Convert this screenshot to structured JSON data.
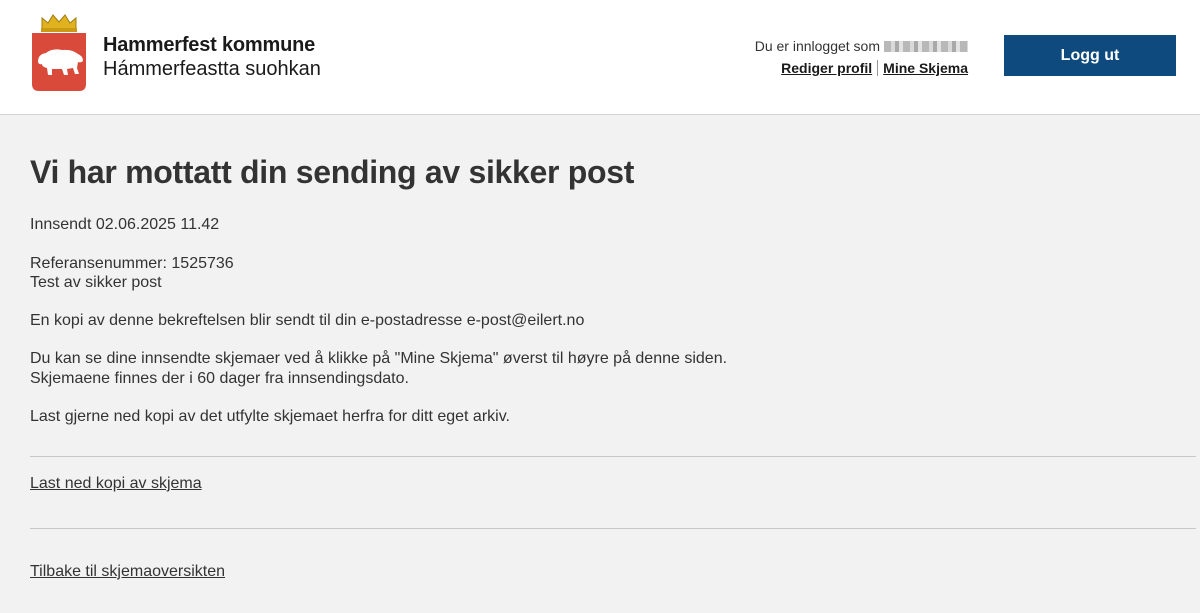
{
  "header": {
    "org_name": "Hammerfest kommune",
    "org_name_sami": "Hámmerfeastta suohkan",
    "logged_in_label": "Du er innlogget som",
    "edit_profile": "Rediger profil",
    "my_forms": "Mine Skjema",
    "logout": "Logg ut"
  },
  "colors": {
    "header_bg": "#ffffff",
    "page_bg": "#f2f2f2",
    "button_bg": "#0f4a7f",
    "shield_red": "#d94a3a",
    "crown_gold": "#e0b21f"
  },
  "main": {
    "title": "Vi har mottatt din sending av sikker post",
    "submitted": "Innsendt 02.06.2025 11.42",
    "reference": "Referansenummer: 1525736",
    "subject": "Test av sikker post",
    "copy_notice": "En kopi av denne bekreftelsen blir sendt til din e-postadresse e-post@eilert.no",
    "info_line1": "Du kan se dine innsendte skjemaer ved å klikke på \"Mine Skjema\" øverst til høyre på denne siden.",
    "info_line2": "Skjemaene finnes der i 60 dager fra innsendingsdato.",
    "download_hint": "Last gjerne ned kopi av det utfylte skjemaet herfra for ditt eget arkiv.",
    "download_link": "Last ned kopi av skjema",
    "back_link": "Tilbake til skjemaoversikten"
  }
}
